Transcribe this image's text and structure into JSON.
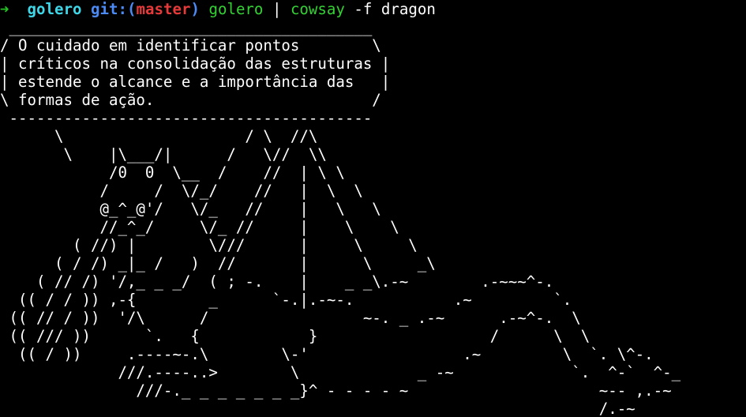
{
  "prompt": {
    "arrow": "➜",
    "directory": "golero",
    "git_label": "git:(",
    "branch": "master",
    "git_close": ")",
    "command_parts": {
      "cmd1": "golero",
      "pipe": "|",
      "cmd2": "cowsay",
      "args": "-f dragon"
    }
  },
  "output_lines": [
    " ________________________________________",
    "/ O cuidado em identificar pontos        \\",
    "| críticos na consolidação das estruturas |",
    "| estende o alcance e a importância das   |",
    "\\ formas de ação.                        /",
    " ----------------------------------------",
    "      \\                    / \\  //\\",
    "       \\    |\\___/|      /   \\//  \\\\",
    "            /0  0  \\__  /    //  | \\ \\",
    "           /     /  \\/_/    //   |  \\  \\",
    "           @_^_@'/   \\/_   //    |   \\   \\",
    "           //_^_/     \\/_ //     |    \\    \\",
    "        ( //) |        \\///      |     \\     \\",
    "      ( / /) _|_ /   )  //       |      \\     _\\",
    "    ( // /) '/,_ _ _/  ( ; -.    |    _ _\\.-~        .-~~~^-.",
    "  (( / / )) ,-{        _      `-.|.-~-.           .~         `.",
    " (( // / ))  '/\\      /                 ~-. _ .-~      .-~^-.  \\",
    " (( /// ))      `.   {            }                   /      \\  \\",
    "  (( / ))     .----~-.\\        \\-'                 .~         \\  `. \\^-.",
    "             ///.----..>        \\             _ -~             `.  ^-`  ^-_",
    "               ///-._ _ _ _ _ _ _}^ - - - - ~                     ~-- ,.-~",
    "                                                                  /.-~"
  ],
  "colors": {
    "background": "#000000",
    "arrow": "#24c324",
    "directory": "#3fd6e8",
    "git": "#4c8bf5",
    "branch": "#e63a3a",
    "command": "#34d234",
    "text": "#ffffff"
  }
}
